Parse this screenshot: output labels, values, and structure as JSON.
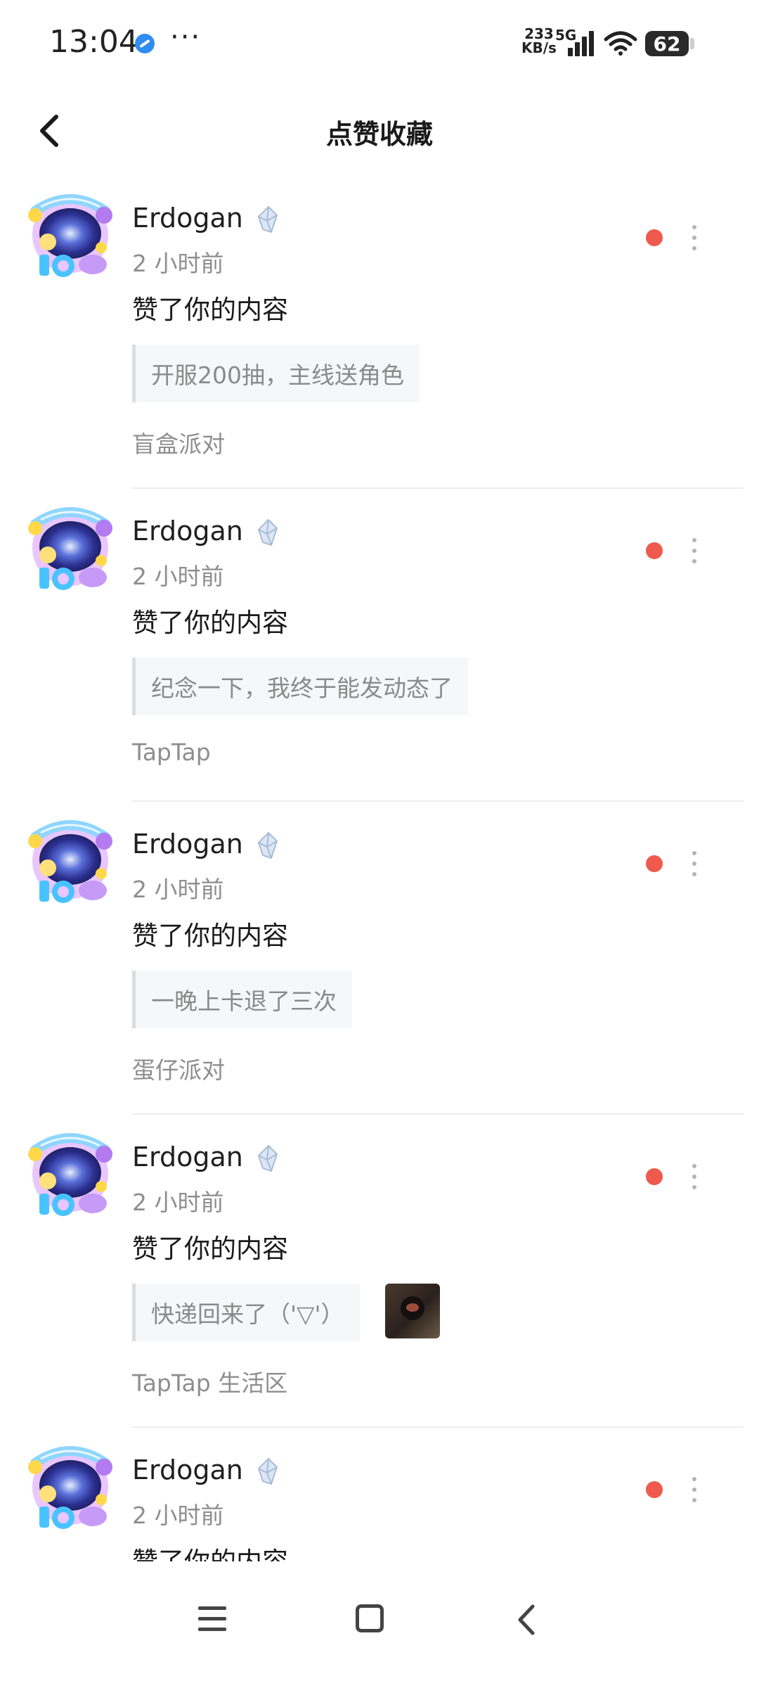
{
  "status_bar": {
    "time": "13:04",
    "speed_value": "233",
    "speed_unit": "KB/s",
    "network": "5G",
    "battery": "62",
    "icons": [
      "app-notification-icon",
      "more-dots-icon",
      "signal-icon",
      "wifi-icon",
      "battery-icon"
    ]
  },
  "header": {
    "title": "点赞收藏",
    "back_icon": "chevron-left-icon"
  },
  "notifications": [
    {
      "username": "Erdogan",
      "time": "2 小时前",
      "action": "赞了你的内容",
      "quote": "开服200抽，主线送角色",
      "source": "盲盒派对",
      "has_thumb": false
    },
    {
      "username": "Erdogan",
      "time": "2 小时前",
      "action": "赞了你的内容",
      "quote": "纪念一下，我终于能发动态了",
      "source": "TapTap",
      "has_thumb": false
    },
    {
      "username": "Erdogan",
      "time": "2 小时前",
      "action": "赞了你的内容",
      "quote": "一晚上卡退了三次",
      "source": "蛋仔派对",
      "has_thumb": false
    },
    {
      "username": "Erdogan",
      "time": "2 小时前",
      "action": "赞了你的内容",
      "quote": "快递回来了（'▽'）",
      "source": "TapTap 生活区",
      "has_thumb": true
    },
    {
      "username": "Erdogan",
      "time": "2 小时前",
      "action": "赞了你的内容",
      "quote": "",
      "source": "",
      "has_thumb": false
    }
  ],
  "colors": {
    "unread_dot": "#ee5a4d",
    "secondary_text": "#8e8e8e",
    "quote_bg": "#f6f7f8"
  },
  "bottom_nav": {
    "icons": [
      "menu-icon",
      "home-square-icon",
      "back-chevron-icon"
    ]
  }
}
